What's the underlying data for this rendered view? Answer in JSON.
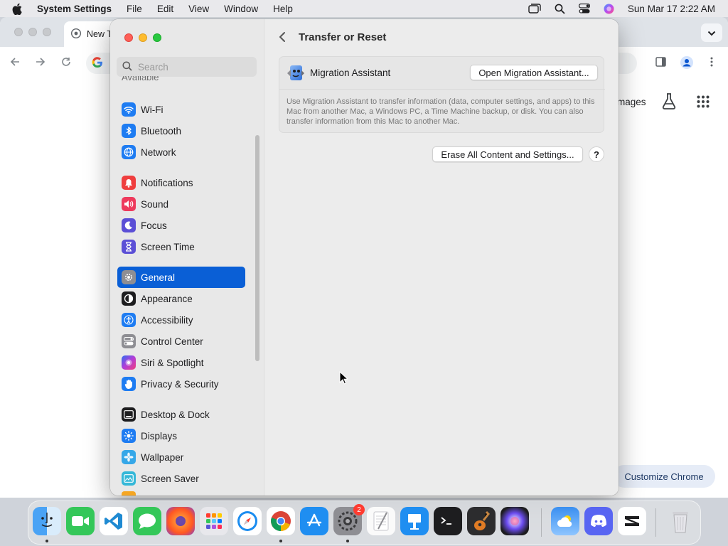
{
  "menubar": {
    "app_name": "System Settings",
    "items": [
      "File",
      "Edit",
      "View",
      "Window",
      "Help"
    ],
    "clock": "Sun Mar 17  2:22 AM"
  },
  "chrome": {
    "tab_title": "New T",
    "images_link": "mages",
    "customize_label": "Customize Chrome"
  },
  "settings": {
    "search_placeholder": "Search",
    "clipped_label": "Available",
    "sidebar": [
      {
        "label": "Wi-Fi",
        "icon": "wifi-icon",
        "color": "#1e7cf2"
      },
      {
        "label": "Bluetooth",
        "icon": "bluetooth-icon",
        "color": "#1e7cf2"
      },
      {
        "label": "Network",
        "icon": "globe-icon",
        "color": "#1e7cf2"
      },
      {
        "label": "Notifications",
        "icon": "bell-icon",
        "color": "#ef3e3e"
      },
      {
        "label": "Sound",
        "icon": "speaker-icon",
        "color": "#ee3a5c"
      },
      {
        "label": "Focus",
        "icon": "moon-icon",
        "color": "#5b4fd6"
      },
      {
        "label": "Screen Time",
        "icon": "hourglass-icon",
        "color": "#5b4fd6"
      },
      {
        "label": "General",
        "icon": "gear-icon",
        "color": "#8e8e93"
      },
      {
        "label": "Appearance",
        "icon": "appearance-icon",
        "color": "#1d1d1f"
      },
      {
        "label": "Accessibility",
        "icon": "accessibility-icon",
        "color": "#1e7cf2"
      },
      {
        "label": "Control Center",
        "icon": "control-center-icon",
        "color": "#8e8e93"
      },
      {
        "label": "Siri & Spotlight",
        "icon": "siri-icon",
        "color": "#9b3dd8"
      },
      {
        "label": "Privacy & Security",
        "icon": "hand-icon",
        "color": "#1e7cf2"
      },
      {
        "label": "Desktop & Dock",
        "icon": "dock-icon",
        "color": "#1d1d1f"
      },
      {
        "label": "Displays",
        "icon": "displays-icon",
        "color": "#1e7cf2"
      },
      {
        "label": "Wallpaper",
        "icon": "wallpaper-icon",
        "color": "#35a7e8"
      },
      {
        "label": "Screen Saver",
        "icon": "screensaver-icon",
        "color": "#35b8d8"
      }
    ],
    "selected_item": "General",
    "page_title": "Transfer or Reset",
    "migration": {
      "label": "Migration Assistant",
      "button": "Open Migration Assistant...",
      "description": "Use Migration Assistant to transfer information (data, computer settings, and apps) to this Mac from another Mac, a Windows PC, a Time Machine backup, or disk. You can also transfer information from this Mac to another Mac."
    },
    "erase_button": "Erase All Content and Settings...",
    "help_button": "?"
  },
  "dock": {
    "apps": [
      "Finder",
      "FaceTime",
      "Visual Studio Code",
      "Messages",
      "Firefox",
      "Launchpad",
      "Safari",
      "Google Chrome",
      "App Store",
      "System Settings",
      "TextEdit",
      "Keynote",
      "Terminal",
      "GarageBand",
      "Siri",
      "Weather",
      "Discord",
      "CapCut",
      "Trash"
    ],
    "system_settings_badge": "2"
  },
  "colors": {
    "accent": "#0a5fd6",
    "sidebar_bg": "#e8e8e8",
    "content_bg": "#ececec"
  }
}
